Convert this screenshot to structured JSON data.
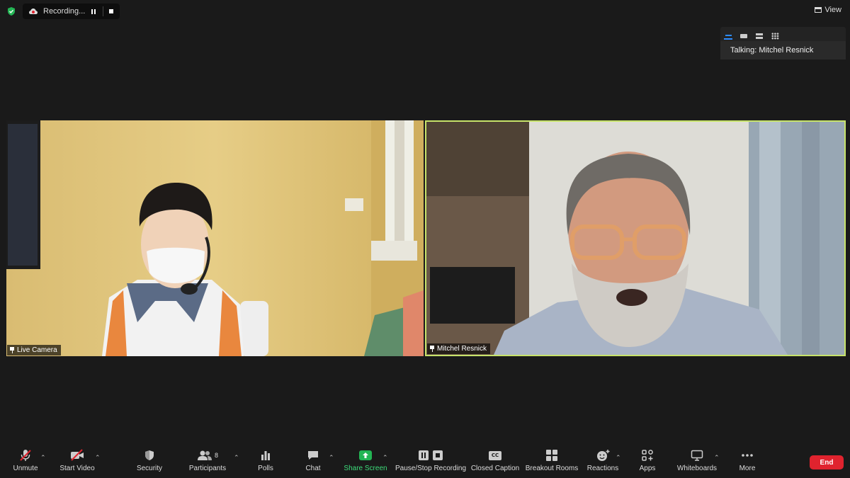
{
  "recording": {
    "label": "Recording..."
  },
  "view": {
    "label": "View"
  },
  "speaker_panel": {
    "talking": "Talking: Mitchel Resnick"
  },
  "tiles": [
    {
      "name": "Live Camera"
    },
    {
      "name": "Mitchel Resnick"
    }
  ],
  "toolbar": {
    "unmute": "Unmute",
    "start_video": "Start Video",
    "security": "Security",
    "participants": "Participants",
    "participant_count": "8",
    "polls": "Polls",
    "chat": "Chat",
    "share_screen": "Share Screen",
    "pause_stop_recording": "Pause/Stop Recording",
    "closed_caption": "Closed Caption",
    "closed_caption_icon_text": "CC",
    "breakout_rooms": "Breakout Rooms",
    "reactions": "Reactions",
    "apps": "Apps",
    "whiteboards": "Whiteboards",
    "more": "More",
    "end": "End"
  },
  "colors": {
    "background": "#1a1a1a",
    "active_speaker_border": "#c7e36a",
    "share_green": "#23b554",
    "end_red": "#e0232e",
    "accent_blue": "#2d8cff"
  }
}
